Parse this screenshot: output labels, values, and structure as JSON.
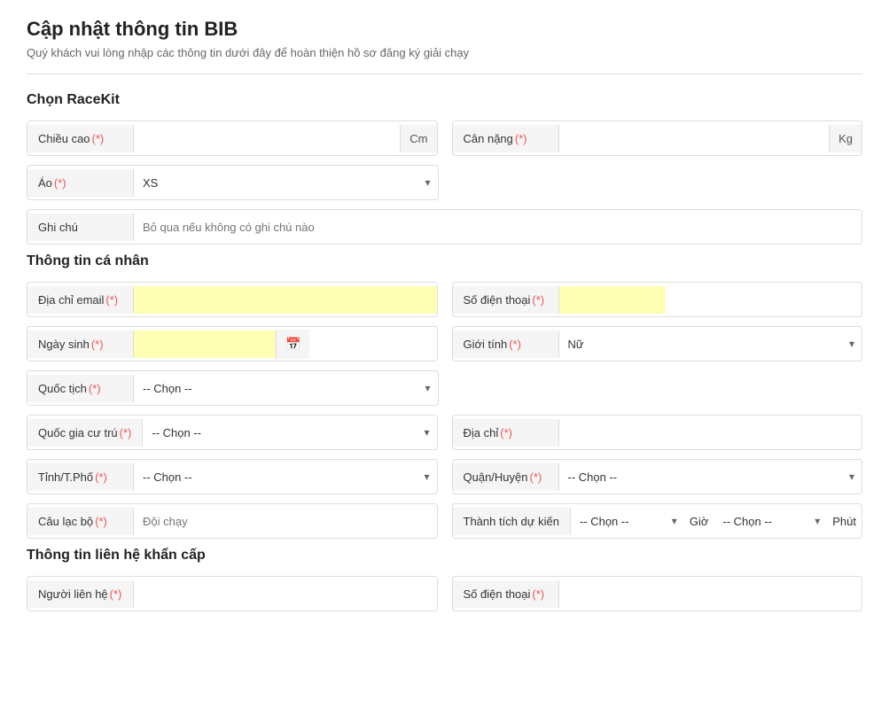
{
  "page": {
    "title": "Cập nhật thông tin BIB",
    "subtitle": "Quý khách vui lòng nhập các thông tin dưới đây để hoàn thiện hồ sơ đăng ký giải chạy"
  },
  "sections": {
    "racekit": {
      "title": "Chọn RaceKit",
      "fields": {
        "height_label": "Chiều cao",
        "height_unit": "Cm",
        "weight_label": "Cân nặng",
        "weight_unit": "Kg",
        "shirt_label": "Áo",
        "shirt_value": "XS",
        "note_label": "Ghi chú",
        "note_placeholder": "Bỏ qua nếu không có ghi chú nào"
      }
    },
    "personal": {
      "title": "Thông tin cá nhân",
      "fields": {
        "email_label": "Địa chỉ email",
        "phone_label": "Số điện thoại",
        "dob_label": "Ngày sinh",
        "gender_label": "Giới tính",
        "gender_value": "Nữ",
        "nationality_label": "Quốc tịch",
        "nationality_placeholder": "-- Chọn --",
        "country_label": "Quốc gia cư trú",
        "country_placeholder": "-- Chọn --",
        "address_label": "Địa chỉ",
        "province_label": "Tỉnh/T.Phố",
        "province_placeholder": "-- Chọn --",
        "district_label": "Quận/Huyện",
        "district_placeholder": "-- Chọn --",
        "club_label": "Câu lạc bộ",
        "club_placeholder": "Đội chạy",
        "achievement_label": "Thành tích dự kiến",
        "achievement_hour_label": "Giờ",
        "achievement_minute_label": "Phút",
        "achievement_placeholder": "-- Chọn --",
        "achievement_hour_placeholder": "-- Chọn --",
        "achievement_minute_placeholder": "-- Chọn --"
      }
    },
    "emergency": {
      "title": "Thông tin liên hệ khẩn cấp",
      "fields": {
        "contact_label": "Người liên hệ",
        "contact_phone_label": "Số điện thoại"
      }
    }
  },
  "required_marker": "(*)",
  "chevron": "▾",
  "calendar": "📅"
}
